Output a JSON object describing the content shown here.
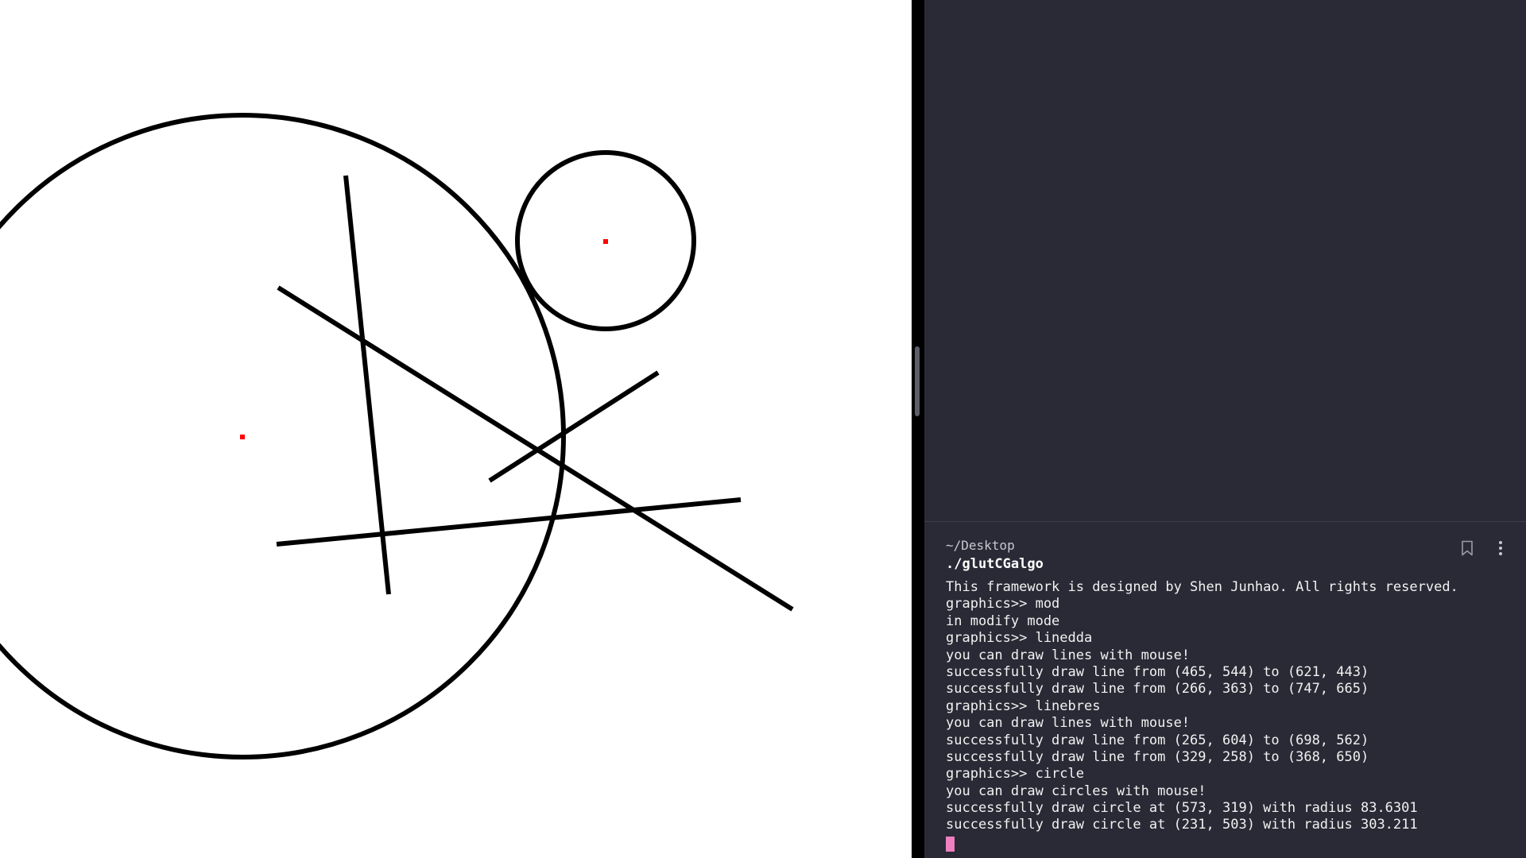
{
  "canvas": {
    "background": "#ffffff",
    "stroke_color": "#000000",
    "center_marker_color": "#ff0000"
  },
  "terminal": {
    "background": "#292a35",
    "cwd": "~/Desktop",
    "command": "./glutCGalgo",
    "output": [
      "This framework is designed by Shen Junhao. All rights reserved.",
      "graphics>> mod",
      "in modify mode",
      "graphics>> linedda",
      "you can draw lines with mouse!",
      "successfully draw line from (465, 544) to (621, 443)",
      "successfully draw line from (266, 363) to (747, 665)",
      "graphics>> linebres",
      "you can draw lines with mouse!",
      "successfully draw line from (265, 604) to (698, 562)",
      "successfully draw line from (329, 258) to (368, 650)",
      "graphics>> circle",
      "you can draw circles with mouse!",
      "successfully draw circle at (573, 319) with radius 83.6301",
      "successfully draw circle at (231, 503) with radius 303.211"
    ],
    "cursor_color": "#f07fc1",
    "icons": {
      "bookmark": "bookmark-icon",
      "more": "more-vertical-icon"
    }
  }
}
